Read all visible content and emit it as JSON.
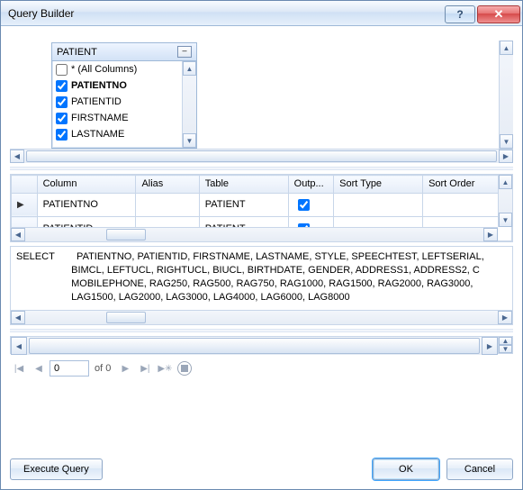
{
  "window": {
    "title": "Query Builder"
  },
  "table_box": {
    "name": "PATIENT",
    "all_columns_label": "* (All Columns)",
    "columns": [
      {
        "name": "PATIENTNO",
        "checked": true,
        "bold": true
      },
      {
        "name": "PATIENTID",
        "checked": true,
        "bold": false
      },
      {
        "name": "FIRSTNAME",
        "checked": true,
        "bold": false
      },
      {
        "name": "LASTNAME",
        "checked": true,
        "bold": false
      }
    ]
  },
  "grid": {
    "headers": {
      "column": "Column",
      "alias": "Alias",
      "table": "Table",
      "output": "Outp...",
      "sort_type": "Sort Type",
      "sort_order": "Sort Order"
    },
    "rows": [
      {
        "column": "PATIENTNO",
        "alias": "",
        "table": "PATIENT",
        "output": true,
        "sort_type": "",
        "sort_order": ""
      },
      {
        "column": "PATIENTID",
        "alias": "",
        "table": "PATIENT",
        "output": true,
        "sort_type": "",
        "sort_order": ""
      }
    ]
  },
  "sql": {
    "keyword": "SELECT",
    "lines": [
      "PATIENTNO, PATIENTID, FIRSTNAME, LASTNAME, STYLE, SPEECHTEST, LEFTSERIAL,",
      "BIMCL, LEFTUCL, RIGHTUCL, BIUCL, BIRTHDATE, GENDER, ADDRESS1, ADDRESS2, C",
      "MOBILEPHONE, RAG250, RAG500, RAG750, RAG1000, RAG1500, RAG2000, RAG3000,",
      "LAG1500, LAG2000, LAG3000, LAG4000, LAG6000, LAG8000"
    ]
  },
  "nav": {
    "current": "0",
    "of_label": "of 0"
  },
  "buttons": {
    "execute": "Execute Query",
    "ok": "OK",
    "cancel": "Cancel"
  }
}
